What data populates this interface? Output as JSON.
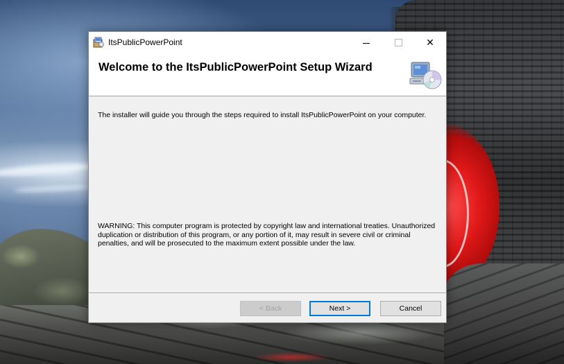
{
  "window": {
    "title": "ItsPublicPowerPoint",
    "controls": {
      "minimize_icon": "minimize-icon",
      "maximize_icon": "maximize-icon",
      "close_icon": "close-icon",
      "close_glyph": "✕"
    }
  },
  "banner": {
    "title": "Welcome to the ItsPublicPowerPoint Setup Wizard",
    "icon": "computer-cd-icon"
  },
  "content": {
    "intro": "The installer will guide you through the steps required to install ItsPublicPowerPoint on your computer.",
    "warning": "WARNING: This computer program is protected by copyright law and international treaties. Unauthorized duplication or distribution of this program, or any portion of it, may result in severe civil or criminal penalties, and will be prosecuted to the maximum extent possible under the law."
  },
  "buttons": {
    "back": "< Back",
    "next": "Next >",
    "cancel": "Cancel"
  },
  "colors": {
    "focus_accent": "#0078d7",
    "dialog_bg": "#f0f0f0"
  }
}
